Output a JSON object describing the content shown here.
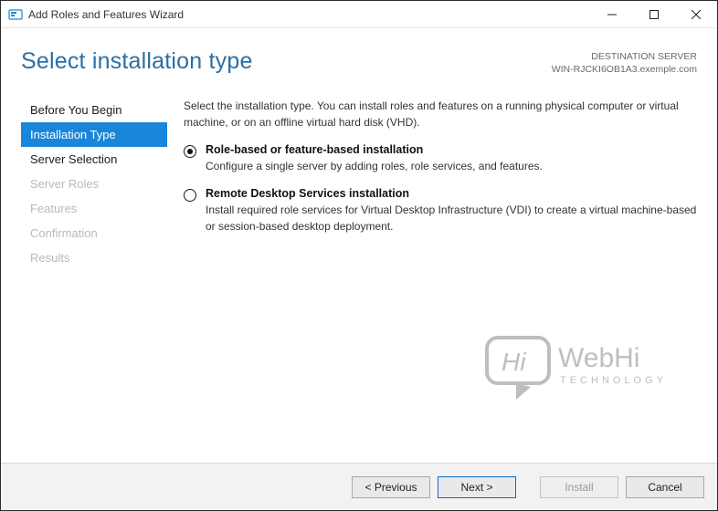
{
  "window": {
    "title": "Add Roles and Features Wizard"
  },
  "header": {
    "page_title": "Select installation type",
    "destination_label": "DESTINATION SERVER",
    "destination_value": "WIN-RJCKI6OB1A3.exemple.com"
  },
  "sidebar": {
    "items": [
      {
        "label": "Before You Begin",
        "state": "normal"
      },
      {
        "label": "Installation Type",
        "state": "active"
      },
      {
        "label": "Server Selection",
        "state": "normal"
      },
      {
        "label": "Server Roles",
        "state": "disabled"
      },
      {
        "label": "Features",
        "state": "disabled"
      },
      {
        "label": "Confirmation",
        "state": "disabled"
      },
      {
        "label": "Results",
        "state": "disabled"
      }
    ]
  },
  "main": {
    "intro": "Select the installation type. You can install roles and features on a running physical computer or virtual machine, or on an offline virtual hard disk (VHD).",
    "options": [
      {
        "title": "Role-based or feature-based installation",
        "desc": "Configure a single server by adding roles, role services, and features.",
        "checked": true
      },
      {
        "title": "Remote Desktop Services installation",
        "desc": "Install required role services for Virtual Desktop Infrastructure (VDI) to create a virtual machine-based or session-based desktop deployment.",
        "checked": false
      }
    ]
  },
  "footer": {
    "previous": "< Previous",
    "next": "Next >",
    "install": "Install",
    "cancel": "Cancel"
  },
  "watermark": {
    "hi": "Hi",
    "brand1": "WebHi",
    "brand2": "TECHNOLOGY"
  }
}
